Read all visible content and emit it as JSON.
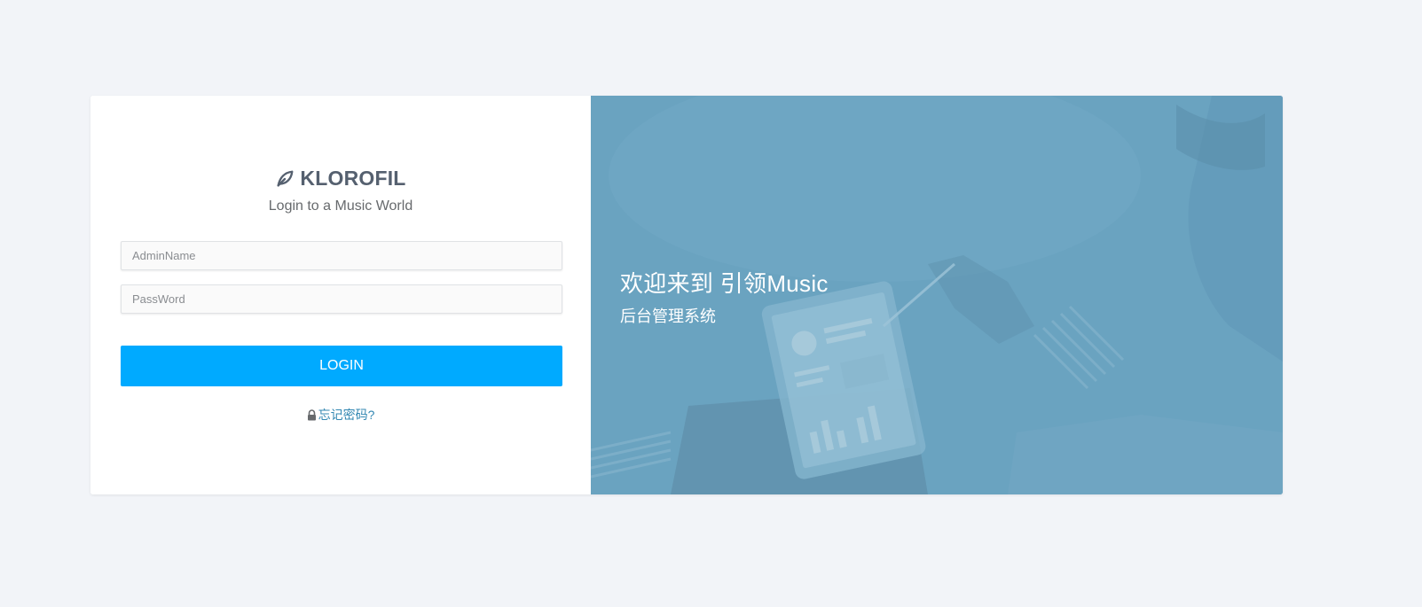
{
  "brand": {
    "logo_text": "KLOROFIL",
    "subtitle": "Login to a Music World"
  },
  "form": {
    "username_placeholder": "AdminName",
    "username_value": "",
    "password_placeholder": "PassWord",
    "password_value": "",
    "login_label": "LOGIN",
    "forgot_label": "忘记密码?"
  },
  "hero": {
    "title": "欢迎来到 引领Music",
    "subtitle": "后台管理系统"
  },
  "colors": {
    "accent": "#00aaff",
    "link": "#3287b2",
    "hero_overlay": "#6aa2c0",
    "page_bg": "#f2f4f8"
  },
  "icons": {
    "logo": "leaf-icon",
    "forgot": "lock-icon"
  }
}
